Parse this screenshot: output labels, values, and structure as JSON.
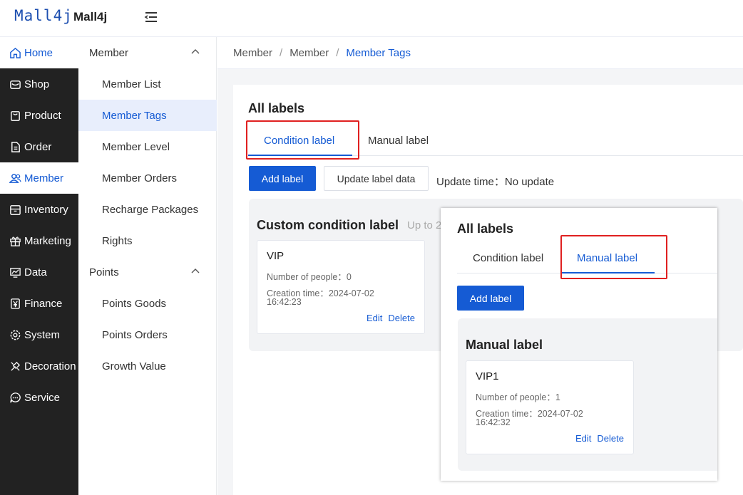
{
  "header": {
    "logo_text": "Mall4j",
    "brand": "Mall4j"
  },
  "rail": [
    {
      "label": "Home",
      "icon": "home-icon"
    },
    {
      "label": "Shop",
      "icon": "shop-icon"
    },
    {
      "label": "Product",
      "icon": "product-icon"
    },
    {
      "label": "Order",
      "icon": "order-icon"
    },
    {
      "label": "Member",
      "icon": "member-icon"
    },
    {
      "label": "Inventory",
      "icon": "inventory-icon"
    },
    {
      "label": "Marketing",
      "icon": "gift-icon"
    },
    {
      "label": "Data",
      "icon": "chart-icon"
    },
    {
      "label": "Finance",
      "icon": "yen-icon"
    },
    {
      "label": "System",
      "icon": "gear-icon"
    },
    {
      "label": "Decoration",
      "icon": "brush-icon"
    },
    {
      "label": "Service",
      "icon": "chat-icon"
    }
  ],
  "submenu": {
    "group1": "Member",
    "items1": [
      "Member List",
      "Member Tags",
      "Member Level",
      "Member Orders",
      "Recharge Packages",
      "Rights"
    ],
    "group2": "Points",
    "items2": [
      "Points Goods",
      "Points Orders",
      "Growth Value"
    ]
  },
  "breadcrumb": [
    "Member",
    "Member",
    "Member Tags"
  ],
  "main": {
    "title": "All labels",
    "tabs": [
      "Condition label",
      "Manual label"
    ],
    "add_label": "Add label",
    "update_label_data": "Update label data",
    "update_time": "Update time：No update",
    "panel_title": "Custom condition label",
    "panel_hint": "Up to 2",
    "card": {
      "name": "VIP",
      "people": "Number of people：0",
      "created": "Creation time：2024-07-02",
      "created_time": "16:42:23",
      "edit": "Edit",
      "delete": "Delete"
    }
  },
  "overlay": {
    "title": "All labels",
    "tabs": [
      "Condition label",
      "Manual label"
    ],
    "add_label": "Add label",
    "panel_title": "Manual label",
    "card": {
      "name": "VIP1",
      "people": "Number of people：1",
      "created": "Creation time：2024-07-02",
      "created_time": "16:42:32",
      "edit": "Edit",
      "delete": "Delete"
    }
  },
  "colors": {
    "accent": "#155bd4",
    "highlight_box": "#e02020",
    "rail_bg": "#222222"
  }
}
